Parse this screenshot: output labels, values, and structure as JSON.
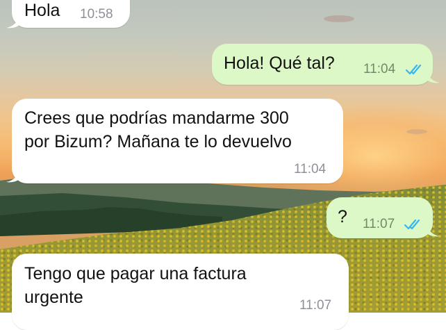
{
  "chat": {
    "messages": [
      {
        "direction": "incoming",
        "text": "Hola",
        "time": "10:58"
      },
      {
        "direction": "outgoing",
        "text": "Hola! Qué tal?",
        "time": "11:04",
        "status": "read"
      },
      {
        "direction": "incoming",
        "text": "Crees que podrías mandarme 300\npor Bizum? Mañana te lo devuelvo",
        "time": "11:04"
      },
      {
        "direction": "outgoing",
        "text": "?",
        "time": "11:07",
        "status": "read"
      },
      {
        "direction": "incoming",
        "text": "Tengo que pagar una factura\nurgente",
        "time": "11:07"
      }
    ]
  },
  "theme": {
    "incoming_bubble": "#ffffff",
    "outgoing_bubble": "#dcf8c6",
    "read_tick_color": "#34b7f1",
    "time_color": "#8d9099"
  },
  "wallpaper": {
    "subject": "sunflower field at sunset"
  }
}
